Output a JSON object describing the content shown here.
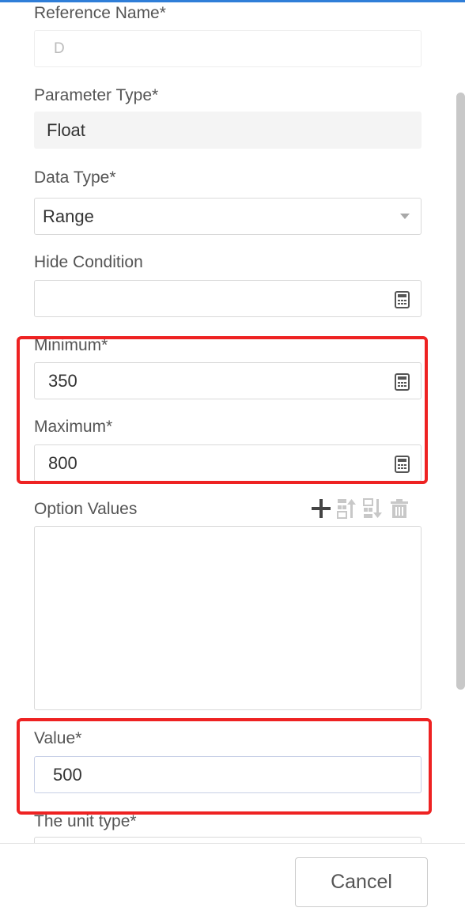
{
  "form": {
    "reference_name": {
      "label": "Reference Name*",
      "value": "D"
    },
    "parameter_type": {
      "label": "Parameter Type*",
      "value": "Float"
    },
    "data_type": {
      "label": "Data Type*",
      "value": "Range"
    },
    "hide_condition": {
      "label": "Hide Condition",
      "value": ""
    },
    "minimum": {
      "label": "Minimum*",
      "value": "350"
    },
    "maximum": {
      "label": "Maximum*",
      "value": "800"
    },
    "option_values": {
      "label": "Option Values",
      "toolbar": [
        "plus-icon",
        "move-up-icon",
        "move-down-icon",
        "trash-icon"
      ]
    },
    "value": {
      "label": "Value*",
      "value": "500"
    },
    "unit_type": {
      "label": "The unit type*"
    }
  },
  "footer": {
    "cancel_label": "Cancel"
  },
  "colors": {
    "highlight": "#ee2222",
    "accent_line": "#2f7ed8"
  }
}
